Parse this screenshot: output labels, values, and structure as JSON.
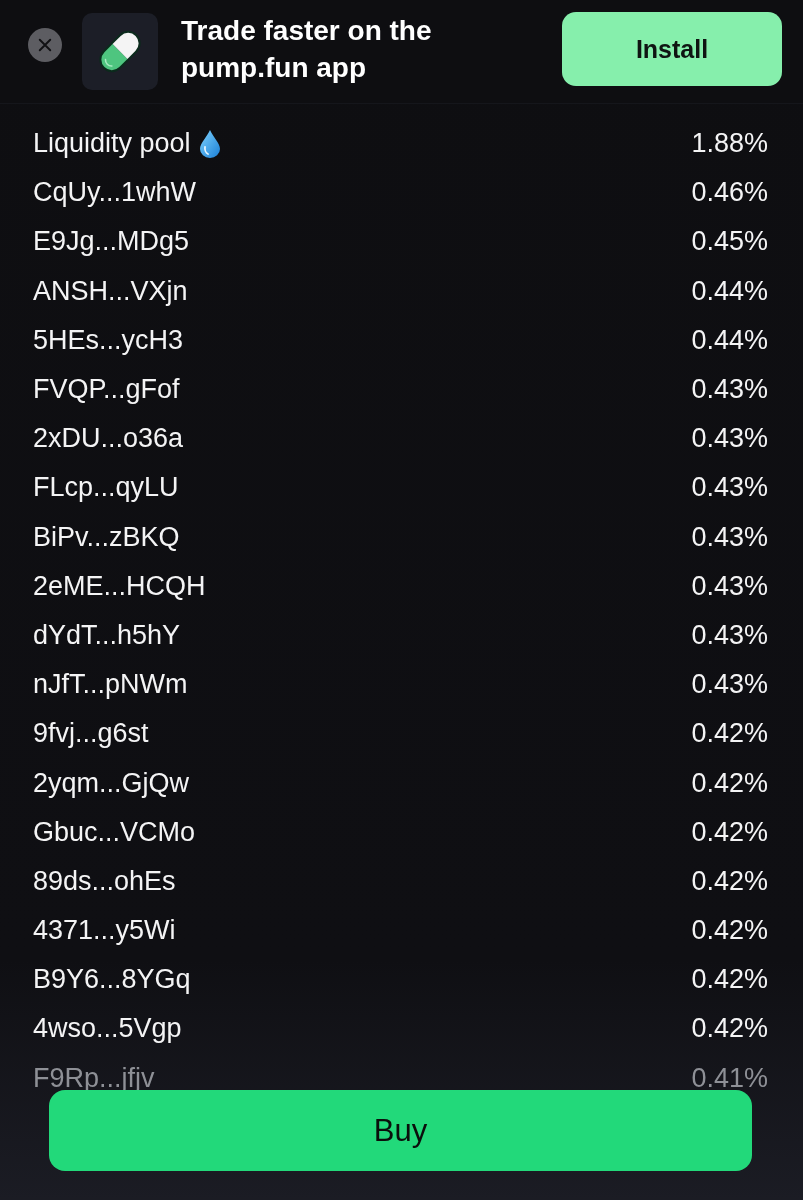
{
  "banner": {
    "title": "Trade faster on the pump.fun app",
    "install_button": "Install"
  },
  "holders": [
    {
      "kind": "pool",
      "label": "Liquidity pool",
      "share": "1.88%",
      "faded": false
    },
    {
      "kind": "wallet",
      "label": "CqUy...1whW",
      "share": "0.46%",
      "faded": false
    },
    {
      "kind": "wallet",
      "label": "E9Jg...MDg5",
      "share": "0.45%",
      "faded": false
    },
    {
      "kind": "wallet",
      "label": "ANSH...VXjn",
      "share": "0.44%",
      "faded": false
    },
    {
      "kind": "wallet",
      "label": "5HEs...ycH3",
      "share": "0.44%",
      "faded": false
    },
    {
      "kind": "wallet",
      "label": "FVQP...gFof",
      "share": "0.43%",
      "faded": false
    },
    {
      "kind": "wallet",
      "label": "2xDU...o36a",
      "share": "0.43%",
      "faded": false
    },
    {
      "kind": "wallet",
      "label": "FLcp...qyLU",
      "share": "0.43%",
      "faded": false
    },
    {
      "kind": "wallet",
      "label": "BiPv...zBKQ",
      "share": "0.43%",
      "faded": false
    },
    {
      "kind": "wallet",
      "label": "2eME...HCQH",
      "share": "0.43%",
      "faded": false
    },
    {
      "kind": "wallet",
      "label": "dYdT...h5hY",
      "share": "0.43%",
      "faded": false
    },
    {
      "kind": "wallet",
      "label": "nJfT...pNWm",
      "share": "0.43%",
      "faded": false
    },
    {
      "kind": "wallet",
      "label": "9fvj...g6st",
      "share": "0.42%",
      "faded": false
    },
    {
      "kind": "wallet",
      "label": "2yqm...GjQw",
      "share": "0.42%",
      "faded": false
    },
    {
      "kind": "wallet",
      "label": "Gbuc...VCMo",
      "share": "0.42%",
      "faded": false
    },
    {
      "kind": "wallet",
      "label": "89ds...ohEs",
      "share": "0.42%",
      "faded": false
    },
    {
      "kind": "wallet",
      "label": "4371...y5Wi",
      "share": "0.42%",
      "faded": false
    },
    {
      "kind": "wallet",
      "label": "B9Y6...8YGq",
      "share": "0.42%",
      "faded": false
    },
    {
      "kind": "wallet",
      "label": "4wso...5Vgp",
      "share": "0.42%",
      "faded": false
    },
    {
      "kind": "wallet",
      "label": "F9Rp...jfjv",
      "share": "0.41%",
      "faded": true
    }
  ],
  "buy_button": "Buy"
}
